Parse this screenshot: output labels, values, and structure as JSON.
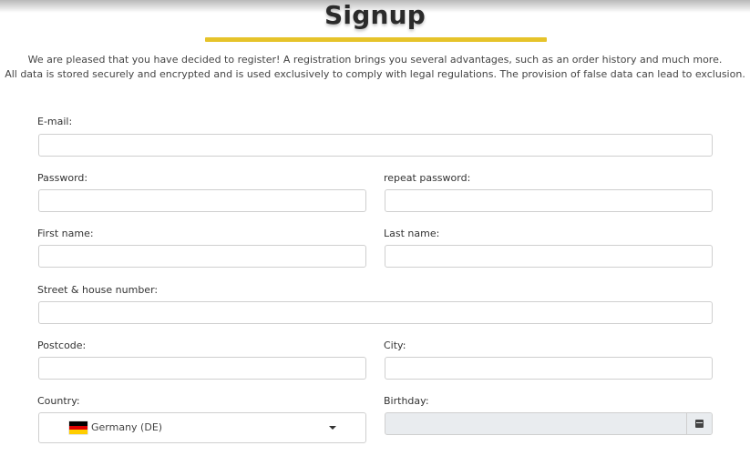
{
  "page": {
    "title": "Signup",
    "intro_line1": "We are pleased that you have decided to register! A registration brings you several advantages, such as an order history and much more.",
    "intro_line2": "All data is stored securely and encrypted and is used exclusively to comply with legal regulations. The provision of false data can lead to exclusion."
  },
  "form": {
    "email_label": "E-mail:",
    "password_label": "Password:",
    "repeat_password_label": "repeat password:",
    "first_name_label": "First name:",
    "last_name_label": "Last name:",
    "street_label": "Street & house number:",
    "postcode_label": "Postcode:",
    "city_label": "City:",
    "country_label": "Country:",
    "country_value": "Germany (DE)",
    "country_flag": "germany-flag",
    "birthday_label": "Birthday:",
    "birthday_icon": "calendar-icon"
  },
  "colors": {
    "accent": "#e6c32a",
    "flag_black": "#000000",
    "flag_red": "#dd0000",
    "flag_gold": "#ffce00",
    "disabled_bg": "#e9ecef"
  }
}
